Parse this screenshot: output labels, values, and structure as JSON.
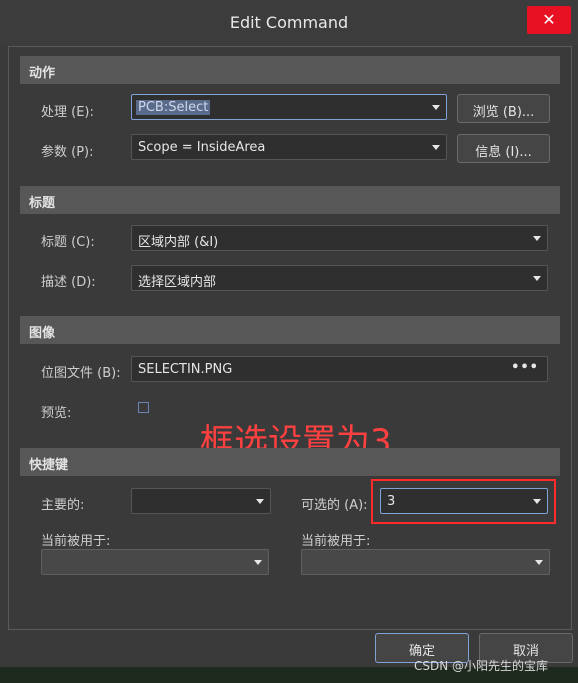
{
  "window": {
    "title": "Edit Command",
    "close_glyph": "✕"
  },
  "action": {
    "header": "动作",
    "process_label": "处理 (E):",
    "process_value": "PCB:Select",
    "browse_button": "浏览 (B)...",
    "params_label": "参数 (P):",
    "params_value": "Scope = InsideArea",
    "info_button": "信息 (I)..."
  },
  "caption": {
    "header": "标题",
    "title_label": "标题 (C):",
    "title_value": "区域内部 (&I)",
    "desc_label": "描述 (D):",
    "desc_value": "选择区域内部"
  },
  "image": {
    "header": "图像",
    "bitmap_label": "位图文件 (B):",
    "bitmap_value": "SELECTIN.PNG",
    "bitmap_dots": "•••",
    "preview_label": "预览:"
  },
  "shortcut": {
    "header": "快捷键",
    "primary_label": "主要的:",
    "primary_value": "",
    "alt_label": "可选的 (A):",
    "alt_value": "3",
    "current_used_label_1": "当前被用于:",
    "current_used_label_2": "当前被用于:"
  },
  "annotation": {
    "text": "框选设置为3",
    "color": "#ff4040"
  },
  "buttons": {
    "ok": "确定",
    "cancel": "取消"
  },
  "watermark": "CSDN @小阳先生的宝库"
}
